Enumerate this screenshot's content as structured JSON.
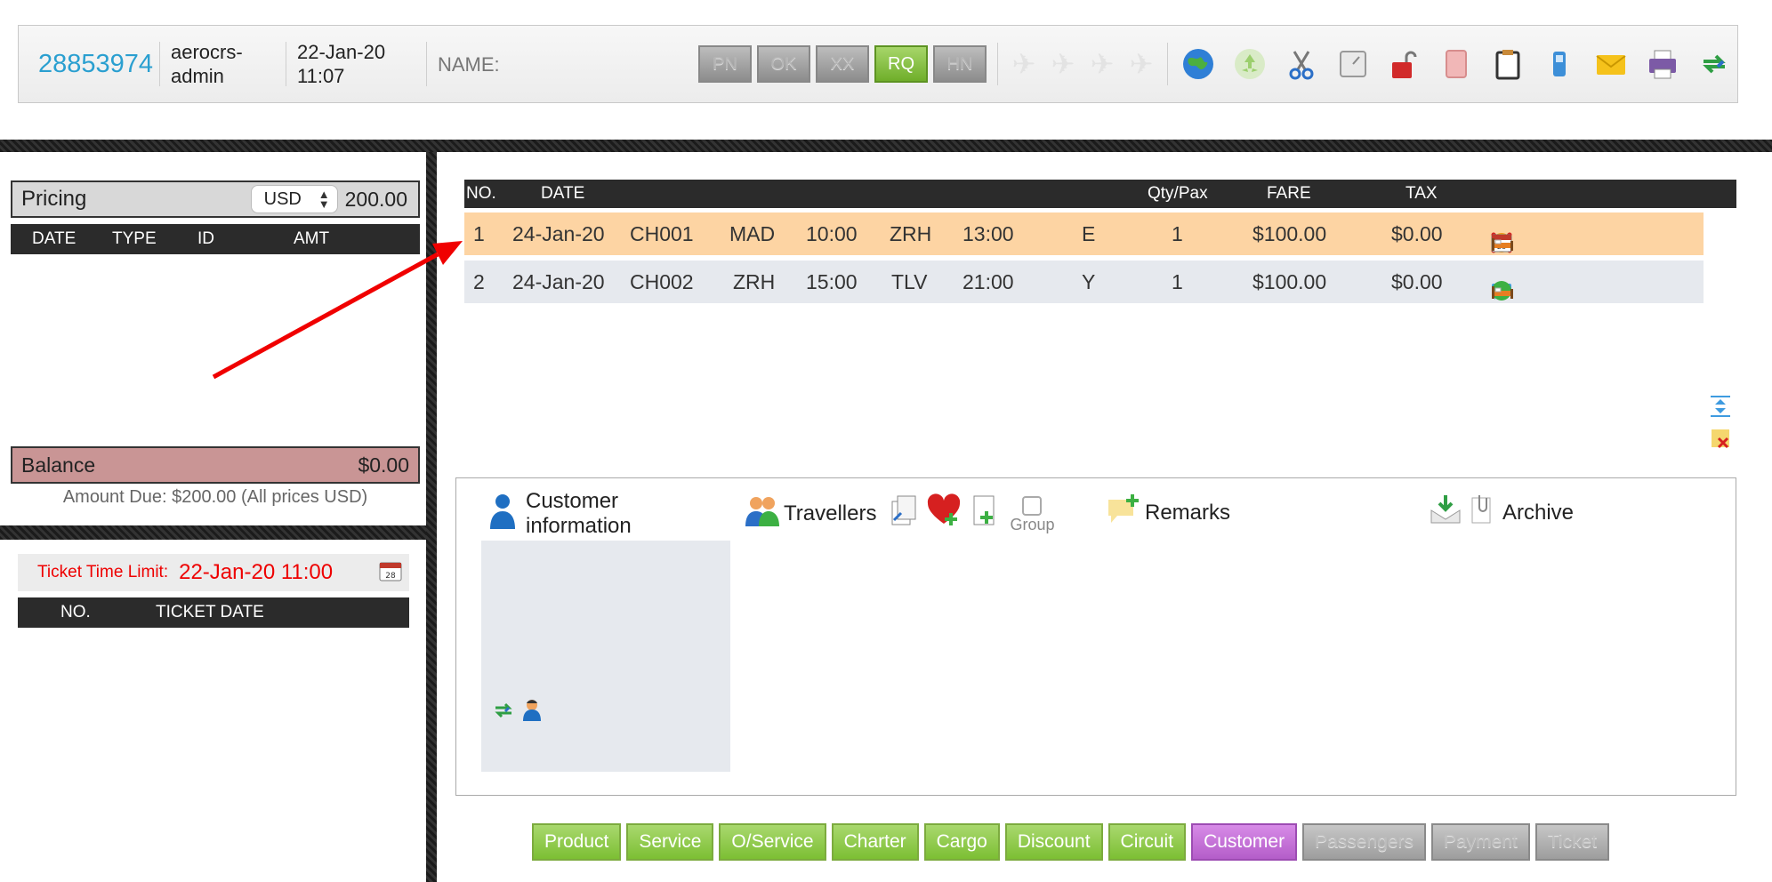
{
  "header": {
    "pnr": "28853974",
    "user": "aerocrs-admin",
    "user_line1": "aerocrs-",
    "user_line2": "admin",
    "date_line1": "22-Jan-20",
    "date_line2": "11:07",
    "name_label": "NAME:",
    "status_buttons": [
      {
        "label": "PN",
        "active": false
      },
      {
        "label": "OK",
        "active": false
      },
      {
        "label": "XX",
        "active": false
      },
      {
        "label": "RQ",
        "active": true
      },
      {
        "label": "HN",
        "active": false
      }
    ],
    "toolbar_icons": [
      "globe-icon",
      "recycle-icon",
      "scissors-icon",
      "clock-icon",
      "unlock-icon",
      "calculator-icon",
      "clipboard-icon",
      "phone-icon",
      "email-icon",
      "printer-icon",
      "sync-icon"
    ]
  },
  "pricing": {
    "label": "Pricing",
    "currency": "USD",
    "amount": "200.00",
    "columns": [
      "DATE",
      "TYPE",
      "ID",
      "AMT"
    ],
    "balance_label": "Balance",
    "balance_value": "$0.00",
    "amount_due": "Amount Due: $200.00 (All prices USD)"
  },
  "ticketing": {
    "time_limit_label": "Ticket Time Limit:",
    "time_limit_value": "22-Jan-20 11:00",
    "columns": [
      "NO.",
      "TICKET DATE"
    ]
  },
  "segments": {
    "columns": [
      "NO.",
      "DATE",
      "Qty/Pax",
      "FARE",
      "TAX"
    ],
    "rows": [
      {
        "no": "1",
        "date": "24-Jan-20",
        "flight": "CH001",
        "from": "MAD",
        "dep": "10:00",
        "to": "ZRH",
        "arr": "13:00",
        "cls": "E",
        "qty": "1",
        "fare": "$100.00",
        "tax": "$0.00"
      },
      {
        "no": "2",
        "date": "24-Jan-20",
        "flight": "CH002",
        "from": "ZRH",
        "dep": "15:00",
        "to": "TLV",
        "arr": "21:00",
        "cls": "Y",
        "qty": "1",
        "fare": "$100.00",
        "tax": "$0.00"
      }
    ]
  },
  "customer": {
    "info_line1": "Customer",
    "info_line2": "information",
    "travellers": "Travellers",
    "group": "Group",
    "remarks": "Remarks",
    "archive": "Archive"
  },
  "tabs": [
    {
      "label": "Product",
      "state": "active"
    },
    {
      "label": "Service",
      "state": "active"
    },
    {
      "label": "O/Service",
      "state": "active"
    },
    {
      "label": "Charter",
      "state": "active"
    },
    {
      "label": "Cargo",
      "state": "active"
    },
    {
      "label": "Discount",
      "state": "active"
    },
    {
      "label": "Circuit",
      "state": "active"
    },
    {
      "label": "Customer",
      "state": "selected"
    },
    {
      "label": "Passengers",
      "state": "disabled"
    },
    {
      "label": "Payment",
      "state": "disabled"
    },
    {
      "label": "Ticket",
      "state": "disabled"
    }
  ],
  "colors": {
    "accent_green": "#7cbf33",
    "pnr_blue": "#2a9fd0",
    "alert_red": "#e00000",
    "row_highlight": "#fdd4a3",
    "customer_tab": "#b45dc9"
  }
}
